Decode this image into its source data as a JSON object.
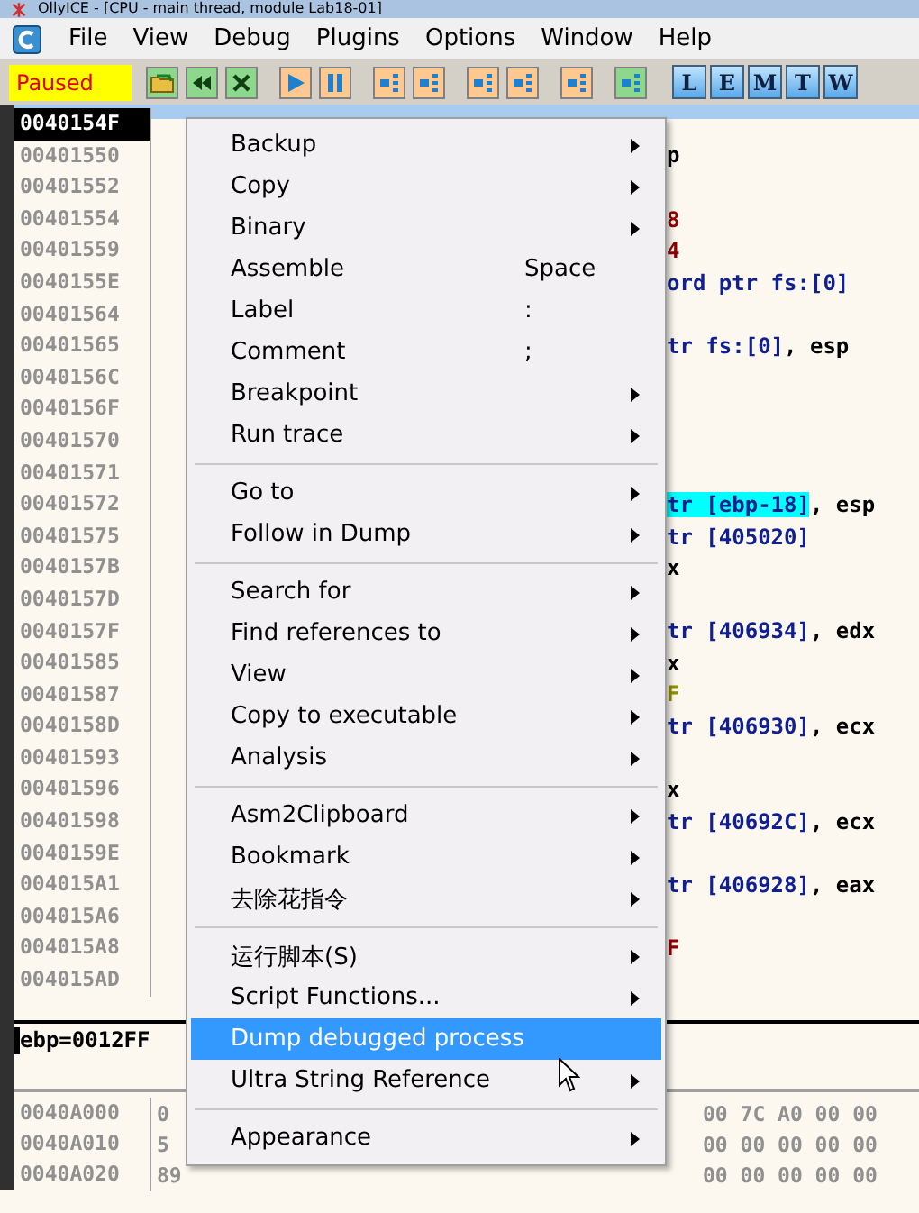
{
  "window": {
    "title": "OllyICE - [CPU - main thread, module Lab18-01]"
  },
  "menu_bar": [
    "File",
    "View",
    "Debug",
    "Plugins",
    "Options",
    "Window",
    "Help"
  ],
  "toolbar": {
    "status": "Paused",
    "letters": [
      "L",
      "E",
      "M",
      "T",
      "W"
    ]
  },
  "disassembly": [
    {
      "address": "0040154F",
      "selected": true
    },
    {
      "address": "00401550",
      "selected": false,
      "text": [
        {
          "kind": "plain",
          "t": "p"
        }
      ]
    },
    {
      "address": "00401552",
      "selected": false
    },
    {
      "address": "00401554",
      "selected": false,
      "text": [
        {
          "kind": "const",
          "t": "8"
        }
      ]
    },
    {
      "address": "00401559",
      "selected": false,
      "text": [
        {
          "kind": "const",
          "t": "4"
        }
      ]
    },
    {
      "address": "0040155E",
      "selected": false,
      "text": [
        {
          "kind": "mem",
          "t": "ord ptr fs:[0]"
        }
      ]
    },
    {
      "address": "00401564",
      "selected": false
    },
    {
      "address": "00401565",
      "selected": false,
      "text": [
        {
          "kind": "mem",
          "t": "tr fs:[0]"
        },
        {
          "kind": "plain",
          "t": ", esp"
        }
      ]
    },
    {
      "address": "0040156C",
      "selected": false
    },
    {
      "address": "0040156F",
      "selected": false
    },
    {
      "address": "00401570",
      "selected": false
    },
    {
      "address": "00401571",
      "selected": false
    },
    {
      "address": "00401572",
      "selected": false,
      "text": [
        {
          "kind": "highlight",
          "t": "tr [ebp-18]"
        },
        {
          "kind": "plain",
          "t": ", esp"
        }
      ]
    },
    {
      "address": "00401575",
      "selected": false,
      "text": [
        {
          "kind": "mem",
          "t": "tr [405020]"
        }
      ]
    },
    {
      "address": "0040157B",
      "selected": false,
      "text": [
        {
          "kind": "plain",
          "t": "x"
        }
      ]
    },
    {
      "address": "0040157D",
      "selected": false
    },
    {
      "address": "0040157F",
      "selected": false,
      "text": [
        {
          "kind": "mem",
          "t": "tr [406934]"
        },
        {
          "kind": "plain",
          "t": ", edx"
        }
      ]
    },
    {
      "address": "00401585",
      "selected": false,
      "text": [
        {
          "kind": "plain",
          "t": "x"
        }
      ]
    },
    {
      "address": "00401587",
      "selected": false,
      "text": [
        {
          "kind": "jump",
          "t": "F"
        }
      ]
    },
    {
      "address": "0040158D",
      "selected": false,
      "text": [
        {
          "kind": "mem",
          "t": "tr [406930]"
        },
        {
          "kind": "plain",
          "t": ", ecx"
        }
      ]
    },
    {
      "address": "00401593",
      "selected": false
    },
    {
      "address": "00401596",
      "selected": false,
      "text": [
        {
          "kind": "plain",
          "t": "x"
        }
      ]
    },
    {
      "address": "00401598",
      "selected": false,
      "text": [
        {
          "kind": "mem",
          "t": "tr [40692C]"
        },
        {
          "kind": "plain",
          "t": ", ecx"
        }
      ]
    },
    {
      "address": "0040159E",
      "selected": false
    },
    {
      "address": "004015A1",
      "selected": false,
      "text": [
        {
          "kind": "mem",
          "t": "tr [406928]"
        },
        {
          "kind": "plain",
          "t": ", eax"
        }
      ]
    },
    {
      "address": "004015A6",
      "selected": false
    },
    {
      "address": "004015A8",
      "selected": false,
      "text": [
        {
          "kind": "const",
          "t": "F"
        }
      ]
    },
    {
      "address": "004015AD",
      "selected": false
    }
  ],
  "registers": {
    "text": "ebp=0012FF"
  },
  "dump": [
    {
      "address": "0040A000",
      "first": "0",
      "bytes": "00 7C A0 00 00"
    },
    {
      "address": "0040A010",
      "first": "5",
      "bytes": "00 00 00 00 00"
    },
    {
      "address": "0040A020",
      "first": "89",
      "bytes": "00 00 00 00 00"
    }
  ],
  "context_menu": [
    {
      "kind": "item",
      "label": "Backup",
      "submenu": true,
      "selected": false
    },
    {
      "kind": "item",
      "label": "Copy",
      "submenu": true,
      "selected": false
    },
    {
      "kind": "item",
      "label": "Binary",
      "submenu": true,
      "selected": false
    },
    {
      "kind": "item",
      "label": "Assemble",
      "shortcut": "Space",
      "submenu": false,
      "selected": false
    },
    {
      "kind": "item",
      "label": "Label",
      "shortcut": ":",
      "submenu": false,
      "selected": false
    },
    {
      "kind": "item",
      "label": "Comment",
      "shortcut": ";",
      "submenu": false,
      "selected": false
    },
    {
      "kind": "item",
      "label": "Breakpoint",
      "submenu": true,
      "selected": false
    },
    {
      "kind": "item",
      "label": "Run trace",
      "submenu": true,
      "selected": false
    },
    {
      "kind": "separator"
    },
    {
      "kind": "item",
      "label": "Go to",
      "submenu": true,
      "selected": false
    },
    {
      "kind": "item",
      "label": "Follow in Dump",
      "submenu": true,
      "selected": false
    },
    {
      "kind": "separator"
    },
    {
      "kind": "item",
      "label": "Search for",
      "submenu": true,
      "selected": false
    },
    {
      "kind": "item",
      "label": "Find references to",
      "submenu": true,
      "selected": false
    },
    {
      "kind": "item",
      "label": "View",
      "submenu": true,
      "selected": false
    },
    {
      "kind": "item",
      "label": "Copy to executable",
      "submenu": true,
      "selected": false
    },
    {
      "kind": "item",
      "label": "Analysis",
      "submenu": true,
      "selected": false
    },
    {
      "kind": "separator"
    },
    {
      "kind": "item",
      "label": "Asm2Clipboard",
      "submenu": true,
      "selected": false
    },
    {
      "kind": "item",
      "label": "Bookmark",
      "submenu": true,
      "selected": false
    },
    {
      "kind": "item",
      "label": "去除花指令",
      "submenu": true,
      "selected": false
    },
    {
      "kind": "separator"
    },
    {
      "kind": "item",
      "label": "运行脚本(S)",
      "submenu": true,
      "selected": false
    },
    {
      "kind": "item",
      "label": "Script Functions...",
      "submenu": true,
      "selected": false
    },
    {
      "kind": "item",
      "label": "Dump debugged process",
      "submenu": false,
      "selected": true
    },
    {
      "kind": "item",
      "label": "Ultra String Reference",
      "submenu": true,
      "selected": false
    },
    {
      "kind": "separator"
    },
    {
      "kind": "item",
      "label": "Appearance",
      "submenu": true,
      "selected": false
    }
  ]
}
